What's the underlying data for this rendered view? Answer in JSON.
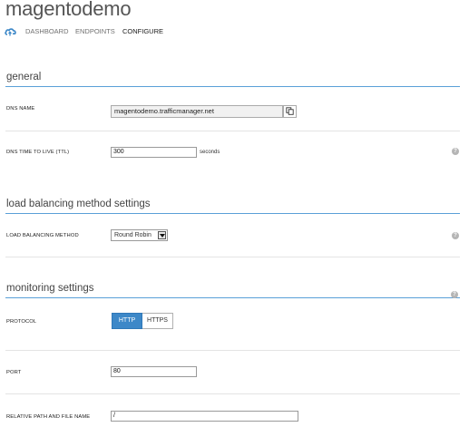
{
  "header": {
    "title": "magentodemo",
    "tabs": [
      {
        "label": "DASHBOARD",
        "active": false
      },
      {
        "label": "ENDPOINTS",
        "active": false
      },
      {
        "label": "CONFIGURE",
        "active": true
      }
    ]
  },
  "sections": {
    "general": {
      "title": "general",
      "dns_name_label": "DNS NAME",
      "dns_name_value": "magentodemo.trafficmanager.net",
      "ttl_label": "DNS TIME TO LIVE (TTL)",
      "ttl_value": "300",
      "ttl_unit": "seconds"
    },
    "load_balancing": {
      "title": "load balancing method settings",
      "method_label": "LOAD BALANCING METHOD",
      "method_value": "Round Robin"
    },
    "monitoring": {
      "title": "monitoring settings",
      "protocol_label": "PROTOCOL",
      "protocol_options": [
        "HTTP",
        "HTTPS"
      ],
      "protocol_selected": "HTTP",
      "port_label": "PORT",
      "port_value": "80",
      "path_label": "RELATIVE PATH AND FILE NAME",
      "path_value": "/"
    }
  },
  "help_glyph": "?",
  "colors": {
    "accent": "#3d88c8",
    "section_rule": "#5aa0d8",
    "row_rule": "#e4e4e4",
    "help_icon": "#b5b5b5"
  },
  "icons": [
    "cloud-logo-icon",
    "copy-icon",
    "help-icon",
    "chevron-down-icon"
  ]
}
